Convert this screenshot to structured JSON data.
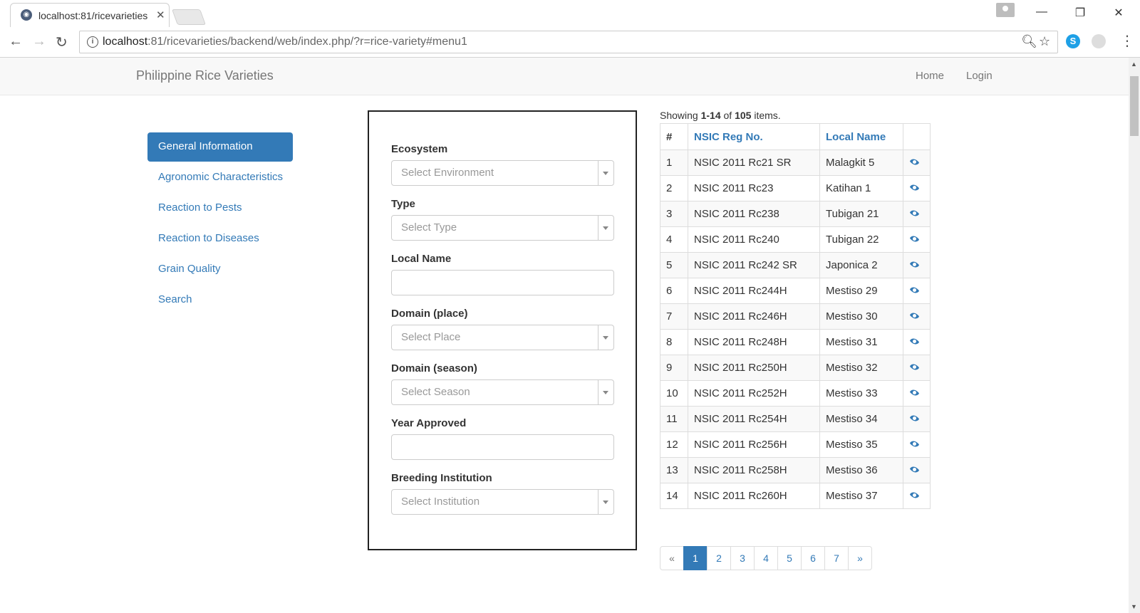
{
  "browser": {
    "tab_title": "localhost:81/ricevarieties",
    "url_host": "localhost",
    "url_rest": ":81/ricevarieties/backend/web/index.php/?r=rice-variety#menu1"
  },
  "navbar": {
    "brand": "Philippine Rice Varieties",
    "links": [
      "Home",
      "Login"
    ]
  },
  "sidebar": {
    "items": [
      {
        "label": "General Information"
      },
      {
        "label": "Agronomic Characteristics"
      },
      {
        "label": "Reaction to Pests"
      },
      {
        "label": "Reaction to Diseases"
      },
      {
        "label": "Grain Quality"
      },
      {
        "label": "Search"
      }
    ]
  },
  "form": {
    "ecosystem": {
      "label": "Ecosystem",
      "placeholder": "Select Environment"
    },
    "type": {
      "label": "Type",
      "placeholder": "Select Type"
    },
    "local_name": {
      "label": "Local Name",
      "value": ""
    },
    "domain_place": {
      "label": "Domain (place)",
      "placeholder": "Select Place"
    },
    "domain_season": {
      "label": "Domain (season)",
      "placeholder": "Select Season"
    },
    "year_approved": {
      "label": "Year Approved",
      "value": ""
    },
    "breeding_institution": {
      "label": "Breeding Institution",
      "placeholder": "Select Institution"
    }
  },
  "grid": {
    "summary": {
      "prefix": "Showing ",
      "range": "1-14",
      "mid": " of ",
      "total": "105",
      "suffix": " items."
    },
    "headers": [
      "#",
      "NSIC Reg No.",
      "Local Name",
      ""
    ],
    "rows": [
      {
        "num": "1",
        "reg": "NSIC 2011 Rc21 SR",
        "name": "Malagkit 5"
      },
      {
        "num": "2",
        "reg": "NSIC 2011 Rc23",
        "name": "Katihan 1"
      },
      {
        "num": "3",
        "reg": "NSIC 2011 Rc238",
        "name": "Tubigan 21"
      },
      {
        "num": "4",
        "reg": "NSIC 2011 Rc240",
        "name": "Tubigan 22"
      },
      {
        "num": "5",
        "reg": "NSIC 2011 Rc242 SR",
        "name": "Japonica 2"
      },
      {
        "num": "6",
        "reg": "NSIC 2011 Rc244H",
        "name": "Mestiso 29"
      },
      {
        "num": "7",
        "reg": "NSIC 2011 Rc246H",
        "name": "Mestiso 30"
      },
      {
        "num": "8",
        "reg": "NSIC 2011 Rc248H",
        "name": "Mestiso 31"
      },
      {
        "num": "9",
        "reg": "NSIC 2011 Rc250H",
        "name": "Mestiso 32"
      },
      {
        "num": "10",
        "reg": "NSIC 2011 Rc252H",
        "name": "Mestiso 33"
      },
      {
        "num": "11",
        "reg": "NSIC 2011 Rc254H",
        "name": "Mestiso 34"
      },
      {
        "num": "12",
        "reg": "NSIC 2011 Rc256H",
        "name": "Mestiso 35"
      },
      {
        "num": "13",
        "reg": "NSIC 2011 Rc258H",
        "name": "Mestiso 36"
      },
      {
        "num": "14",
        "reg": "NSIC 2011 Rc260H",
        "name": "Mestiso 37"
      }
    ],
    "row_icon": "eye-icon"
  },
  "pagination": {
    "prev": "«",
    "pages": [
      "1",
      "2",
      "3",
      "4",
      "5",
      "6",
      "7"
    ],
    "next": "»",
    "active": "1"
  },
  "colors": {
    "primary": "#337ab7",
    "navbar_bg": "#f8f8f8"
  }
}
